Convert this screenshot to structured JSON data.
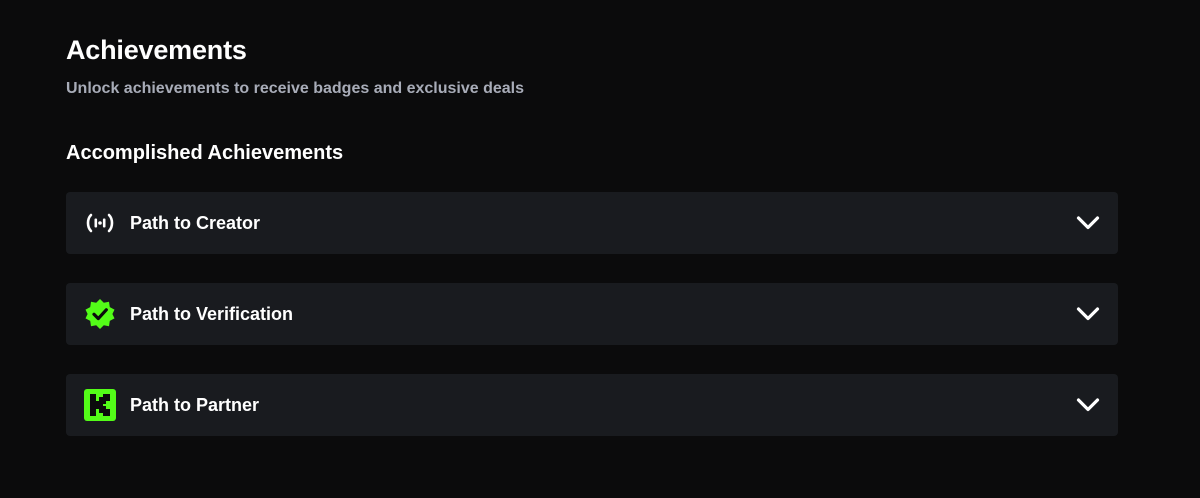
{
  "header": {
    "title": "Achievements",
    "subtitle": "Unlock achievements to receive badges and exclusive deals"
  },
  "section": {
    "title": "Accomplished Achievements"
  },
  "achievements": [
    {
      "label": "Path to Creator",
      "icon": "broadcast-icon",
      "icon_color": "#ffffff"
    },
    {
      "label": "Path to Verification",
      "icon": "verified-badge-icon",
      "icon_color": "#53fc18"
    },
    {
      "label": "Path to Partner",
      "icon": "kick-logo-icon",
      "icon_color": "#53fc18"
    }
  ],
  "colors": {
    "background": "#0b0b0c",
    "card": "#191b1f",
    "accent": "#53fc18",
    "subtitle": "#a8acb8"
  }
}
